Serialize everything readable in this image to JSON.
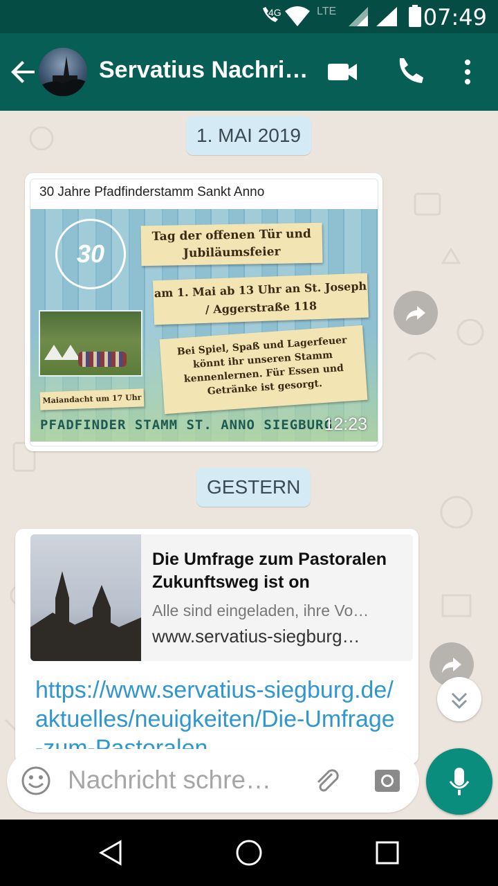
{
  "status_bar": {
    "time": "07:49",
    "network_4g": "4G",
    "network_lte": "LTE"
  },
  "header": {
    "title": "Servatius Nachri…"
  },
  "chat": {
    "date_chip_1": "1. MAI 2019",
    "message_1": {
      "preview_title": "30 Jahre Pfadfinderstamm Sankt Anno",
      "poster": {
        "note_1": "Tag der offenen Tür und Jubiläumsfeier",
        "note_2": "am 1. Mai ab 13 Uhr an St. Joseph / Aggerstraße 118",
        "note_3": "Bei Spiel, Spaß und Lagerfeuer könnt ihr unseren Stamm kennenlernen. Für Essen und Getränke ist gesorgt.",
        "note_4": "Maiandacht um 17 Uhr",
        "logo_number": "30",
        "footer": "PFADFINDER STAMM ST. ANNO SIEGBURG"
      },
      "time": "12:23"
    },
    "date_chip_2": "GESTERN",
    "message_2": {
      "preview_title": "Die Umfrage zum Pastoralen Zukunftsweg ist on",
      "preview_description": "Alle sind eingeladen, ihre Vo…",
      "preview_domain": "www.servatius-siegburg…",
      "link_text": "https://www.servatius-siegburg.de/aktuelles/neuigkeiten/Die-Umfrage-zum-Pastoralen"
    }
  },
  "input": {
    "placeholder": "Nachricht schre…"
  },
  "colors": {
    "primary": "#075e54",
    "status_bar": "#054d44",
    "accent": "#0a8d7d",
    "date_chip": "#d4eaf4",
    "link": "#2f96cf"
  },
  "icons": [
    "back-arrow-icon",
    "video-call-icon",
    "phone-icon",
    "more-vert-icon",
    "forward-icon",
    "chevron-double-down-icon",
    "emoji-icon",
    "attach-icon",
    "camera-icon",
    "mic-icon",
    "nav-back-icon",
    "nav-home-icon",
    "nav-recents-icon"
  ]
}
